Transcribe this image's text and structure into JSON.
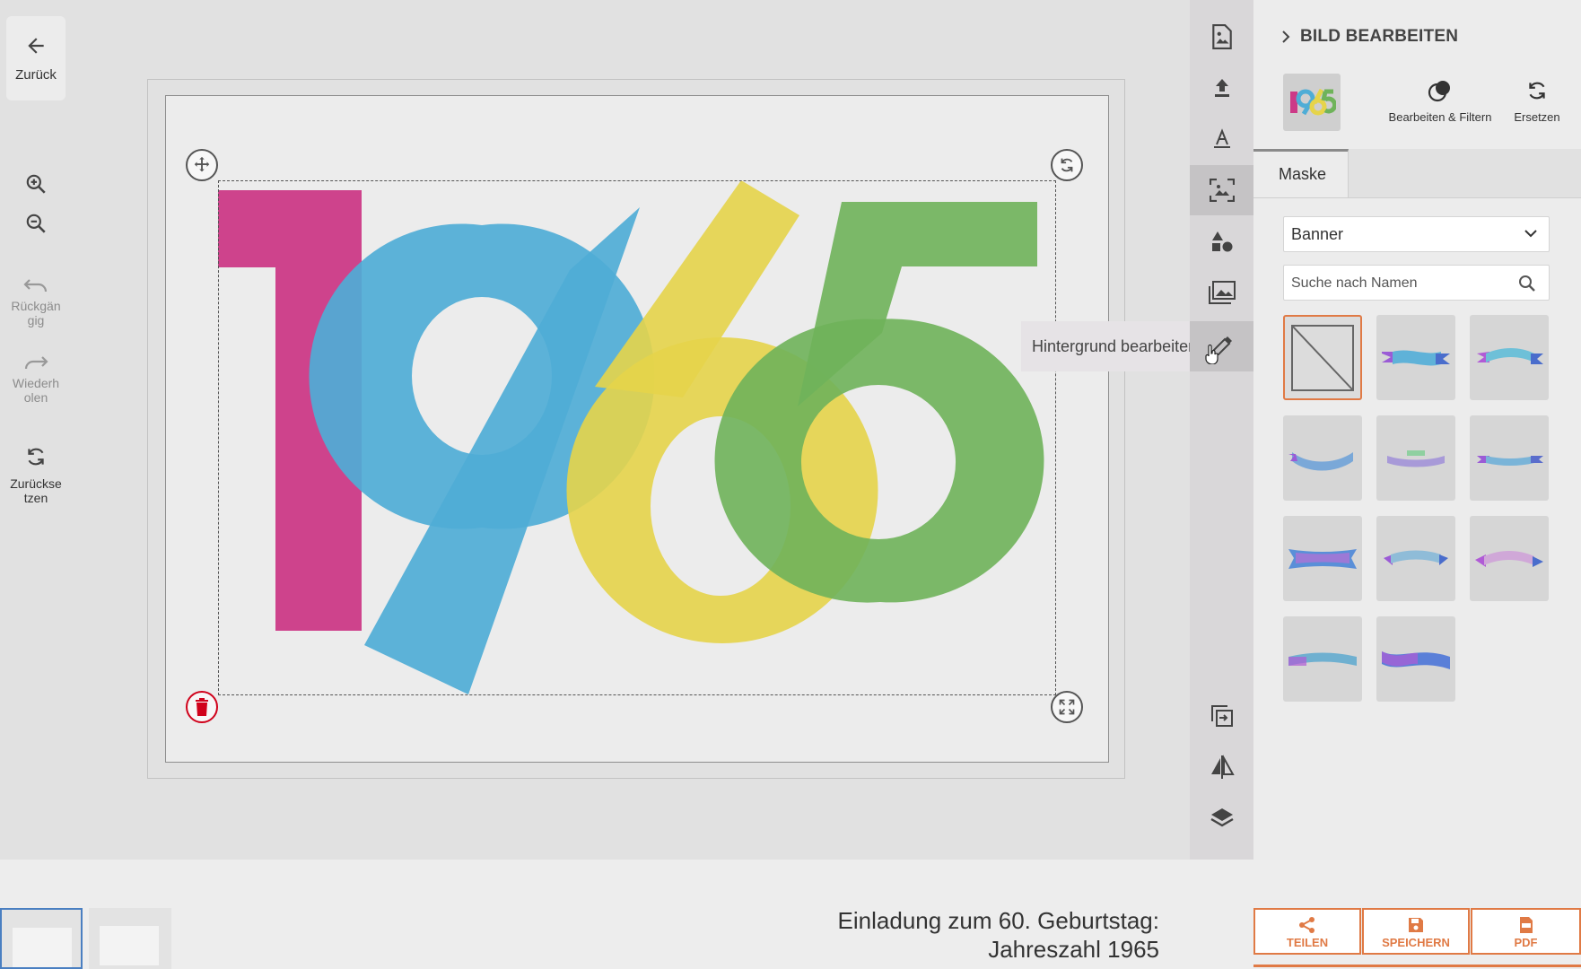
{
  "left_toolbar": {
    "back_label": "Zurück",
    "undo_label_1": "Rückgän",
    "undo_label_2": "gig",
    "redo_label_1": "Wiederh",
    "redo_label_2": "olen",
    "reset_label_1": "Zurückse",
    "reset_label_2": "tzen"
  },
  "canvas": {
    "artwork_text": "1965",
    "colors": {
      "one": "#cc3a87",
      "nine": "#52b0d8",
      "six": "#e6d44a",
      "five": "#79b962"
    }
  },
  "tooltip": "Hintergrund bearbeiten",
  "panel": {
    "title": "BILD BEARBEITEN",
    "thumb_text": "1965",
    "actions": {
      "edit_filter": "Bearbeiten & Filtern",
      "replace": "Ersetzen"
    },
    "tab": "Maske",
    "select_value": "Banner",
    "search_placeholder": "Suche nach Namen",
    "mask_items": [
      "none",
      "banner-1",
      "banner-2",
      "banner-3",
      "banner-4",
      "banner-5",
      "banner-6",
      "banner-7",
      "banner-8",
      "banner-9",
      "banner-10"
    ]
  },
  "bottom": {
    "title_line1": "Einladung zum 60. Geburtstag:",
    "title_line2": "Jahreszahl 1965",
    "share": "TEILEN",
    "save": "SPEICHERN",
    "pdf": "PDF"
  },
  "accent_color": "#e07a45"
}
